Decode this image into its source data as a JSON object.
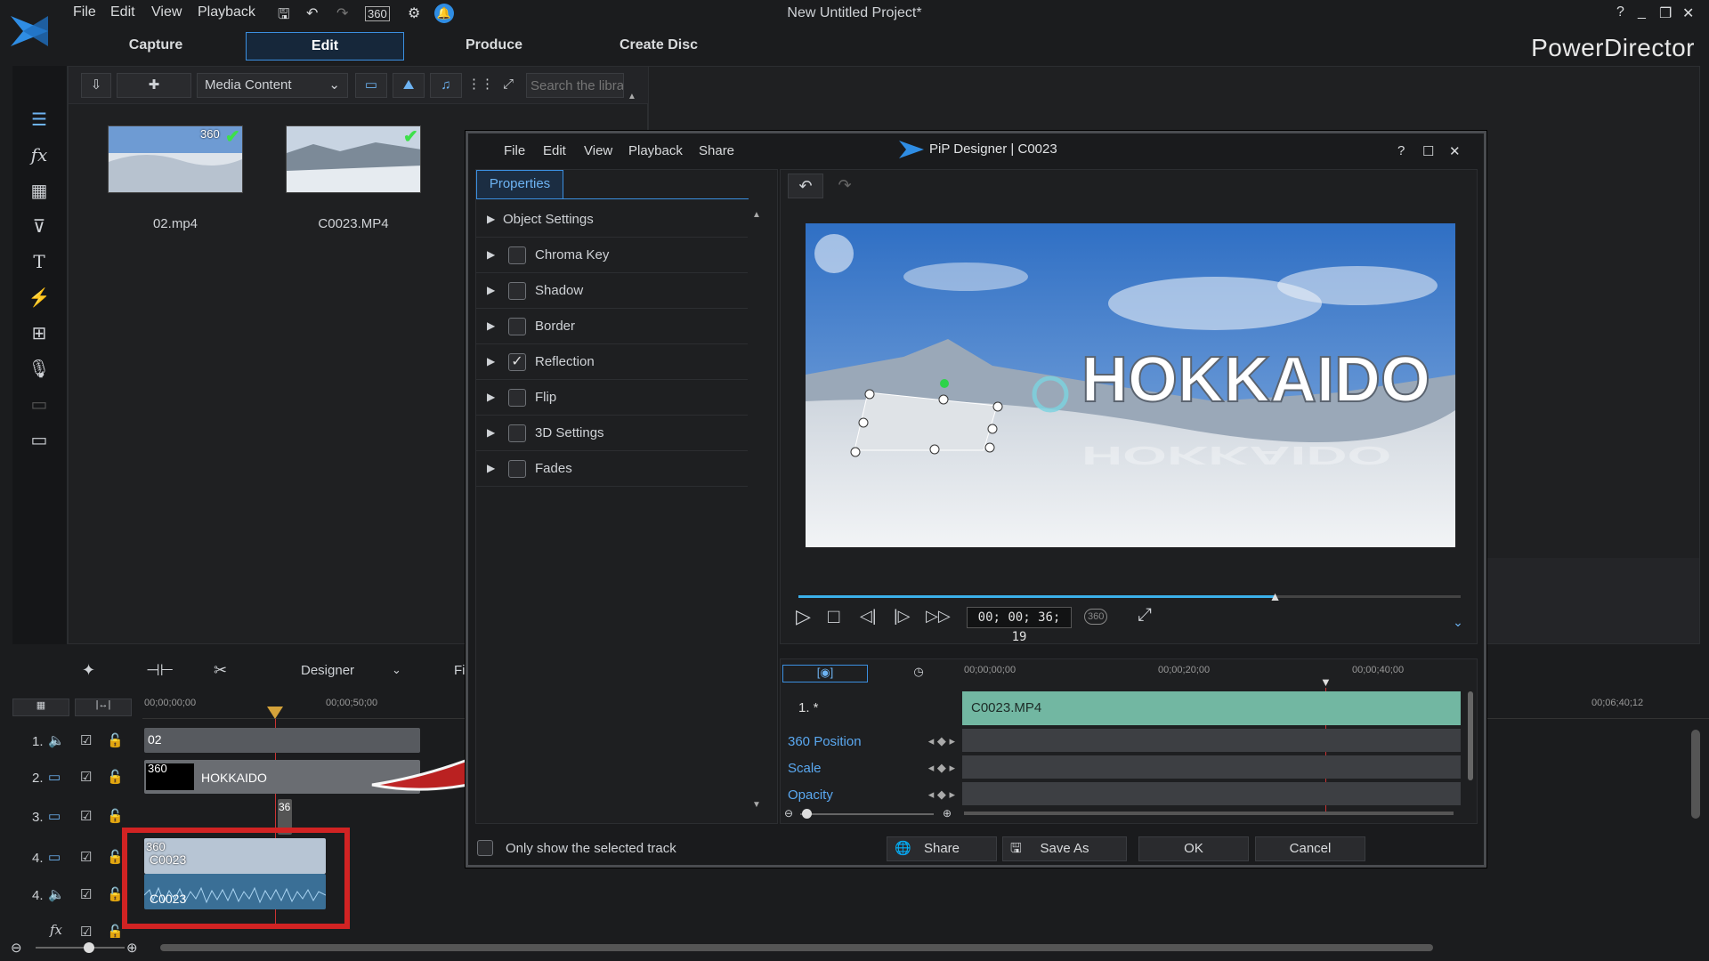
{
  "app": {
    "title": "New Untitled Project*",
    "brand": "PowerDirector",
    "menu": [
      "File",
      "Edit",
      "View",
      "Playback"
    ],
    "modes": [
      "Capture",
      "Edit",
      "Produce",
      "Create Disc"
    ],
    "active_mode": "Edit"
  },
  "library": {
    "dropdown": "Media Content",
    "search_placeholder": "Search the libra",
    "items": [
      {
        "label": "02.mp4",
        "badge": "360"
      },
      {
        "label": "C0023.MP4",
        "badge": ""
      }
    ]
  },
  "timeline": {
    "mode_dropdown": "Designer",
    "toolbar_trailing": "Fi",
    "ruler": [
      "00;00;00;00",
      "00;00;50;00",
      "00;06;40;12"
    ],
    "tracks": [
      {
        "num": "1.",
        "clip": "02"
      },
      {
        "num": "2.",
        "clip": "HOKKAIDO",
        "badge": "360"
      },
      {
        "num": "3.",
        "clip": "",
        "badge": "36"
      },
      {
        "num": "4.",
        "clip": "C0023",
        "badge": "360"
      },
      {
        "num": "4.",
        "clip": "C0023"
      }
    ],
    "fx_label": "fx"
  },
  "pip": {
    "menu": [
      "File",
      "Edit",
      "View",
      "Playback",
      "Share"
    ],
    "title": "PiP Designer  |  C0023",
    "tab": "Properties",
    "properties": [
      {
        "label": "Object Settings",
        "checkbox": false,
        "checked": false
      },
      {
        "label": "Chroma Key",
        "checkbox": true,
        "checked": false
      },
      {
        "label": "Shadow",
        "checkbox": true,
        "checked": false
      },
      {
        "label": "Border",
        "checkbox": true,
        "checked": false
      },
      {
        "label": "Reflection",
        "checkbox": true,
        "checked": true
      },
      {
        "label": "Flip",
        "checkbox": true,
        "checked": false
      },
      {
        "label": "3D Settings",
        "checkbox": true,
        "checked": false
      },
      {
        "label": "Fades",
        "checkbox": true,
        "checked": false
      }
    ],
    "only_show_selected": "Only show the selected track",
    "video_text": "HOKKAIDO",
    "timecode": "00; 00; 36; 19",
    "seek_progress": 0.72,
    "tl_ruler": [
      "00;00;00;00",
      "00;00;20;00",
      "00;00;40;00"
    ],
    "track_label": "1. *",
    "clip": "C0023.MP4",
    "keyframes": [
      "360 Position",
      "Scale",
      "Opacity"
    ],
    "buttons": {
      "share": "Share",
      "save_as": "Save As",
      "ok": "OK",
      "cancel": "Cancel"
    }
  }
}
